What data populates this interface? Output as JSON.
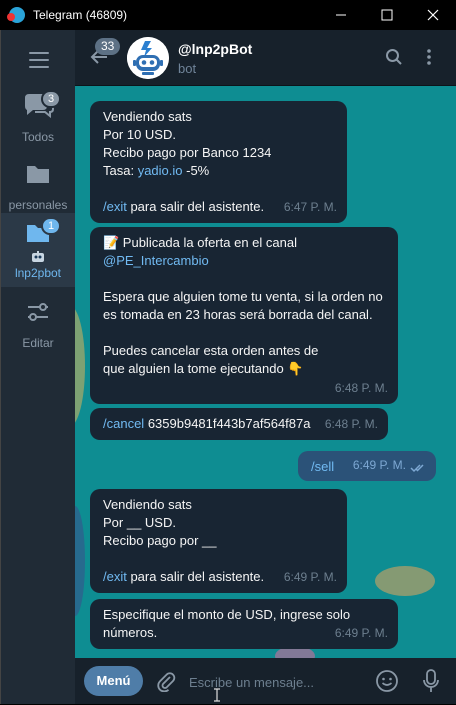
{
  "window": {
    "title": "Telegram (46809)",
    "minimize": "—",
    "maximize": "☐",
    "close": "✕"
  },
  "folders": [
    {
      "label": "Todos",
      "badge": "3"
    },
    {
      "label": "personales"
    },
    {
      "label": "lnp2pbot",
      "badge": "1"
    },
    {
      "label": "Editar"
    }
  ],
  "header": {
    "back_badge": "33",
    "chat_name": "@lnp2pBot",
    "status": "bot"
  },
  "messages": [
    {
      "lines": [
        "Vendiendo sats",
        "Por 10 USD.",
        "Recibo pago por Banco 1234"
      ],
      "rate_label": "Tasa: ",
      "rate_link": "yadio.io",
      "rate_rest": " -5%",
      "exit_cmd": "/exit",
      "exit_text": " para salir del asistente.",
      "time": "6:47 P. M."
    },
    {
      "title_emoji": "📝",
      "title_text": " Publicada la oferta en el canal",
      "channel": "@PE_Intercambio",
      "body1": "Espera que alguien tome tu venta, si la orden no es tomada en 23 horas será borrada del canal.",
      "body2": "Puedes cancelar esta orden antes de que alguien la tome ejecutando 👇",
      "time": "6:48 P. M."
    },
    {
      "cmd": "/cancel",
      "text": " 6359b9481f443b7af564f87a",
      "time": "6:48 P. M."
    },
    {
      "cmd": "/sell",
      "time": "6:49 P. M.",
      "outgoing": true
    },
    {
      "lines": [
        "Vendiendo sats",
        "Por __ USD.",
        "Recibo pago por __"
      ],
      "exit_cmd": "/exit",
      "exit_text": " para salir del asistente.",
      "time": "6:49 P. M."
    },
    {
      "text": "Especifique el monto de USD, ingrese solo números.",
      "time": "6:49 P. M."
    }
  ],
  "input": {
    "menu_label": "Menú",
    "placeholder": "Escribe un mensaje..."
  },
  "colors": {
    "accent": "#6fb7ee",
    "link": "#71baf2",
    "outgoing": "#2b5278",
    "incoming": "#182533",
    "chat_bg": "#0e8d92"
  }
}
